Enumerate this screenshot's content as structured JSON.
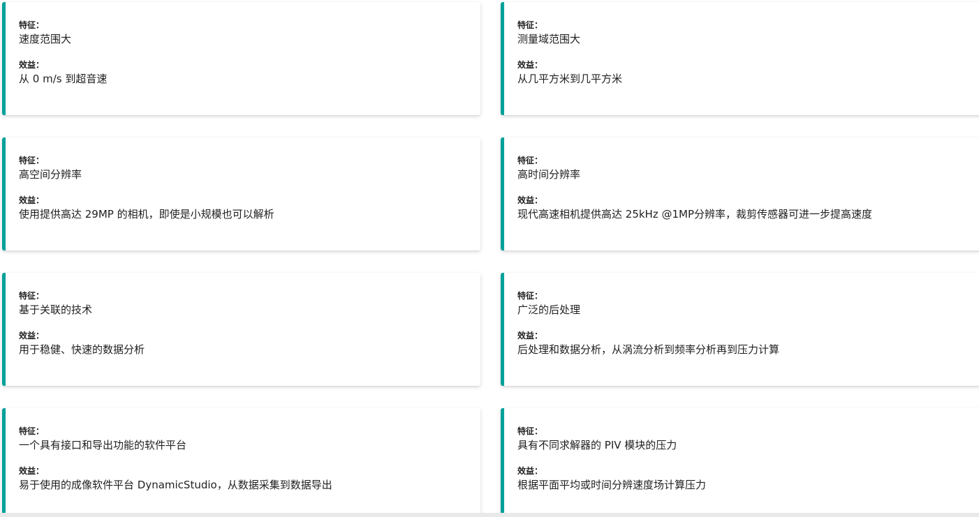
{
  "accent_color": "#00a19a",
  "cards": [
    {
      "feature_label": "特征：",
      "feature": "速度范围大",
      "benefit_label": "效益：",
      "benefit": "从 0 m/s 到超音速"
    },
    {
      "feature_label": "特征：",
      "feature": "测量域范围大",
      "benefit_label": "效益：",
      "benefit": "从几平方米到几平方米"
    },
    {
      "feature_label": "特征：",
      "feature": "高空间分辨率",
      "benefit_label": "效益：",
      "benefit": "使用提供高达 29MP 的相机，即使是小规模也可以解析"
    },
    {
      "feature_label": "特征：",
      "feature": "高时间分辨率",
      "benefit_label": "效益：",
      "benefit": "现代高速相机提供高达 25kHz @1MP分辨率，裁剪传感器可进一步提高速度"
    },
    {
      "feature_label": "特征：",
      "feature": "基于关联的技术",
      "benefit_label": "效益：",
      "benefit": "用于稳健、快速的数据分析"
    },
    {
      "feature_label": "特征：",
      "feature": "广泛的后处理",
      "benefit_label": "效益：",
      "benefit": "后处理和数据分析，从涡流分析到频率分析再到压力计算"
    },
    {
      "feature_label": "特征：",
      "feature": "一个具有接口和导出功能的软件平台",
      "benefit_label": "效益：",
      "benefit": "易于使用的成像软件平台 DynamicStudio，从数据采集到数据导出"
    },
    {
      "feature_label": "特征：",
      "feature": "具有不同求解器的 PIV 模块的压力",
      "benefit_label": "效益：",
      "benefit": "根据平面平均或时间分辨速度场计算压力"
    }
  ]
}
